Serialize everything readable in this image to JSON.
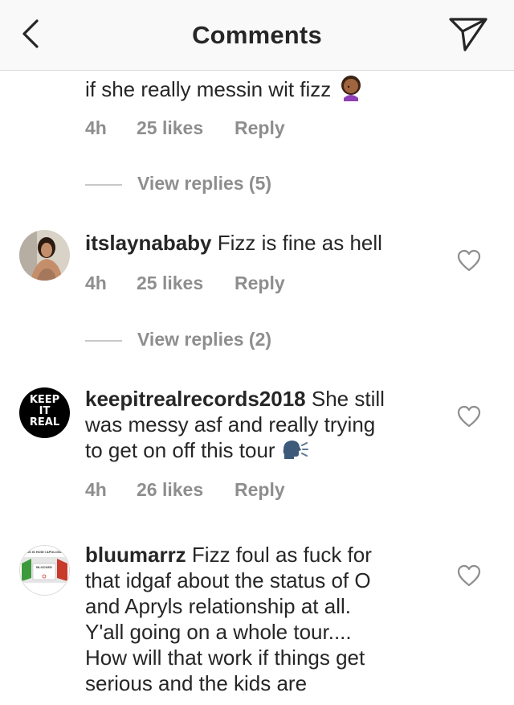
{
  "header": {
    "title": "Comments"
  },
  "comments": [
    {
      "text": "if she really messin wit fizz",
      "emoji": "face-palm-emoji",
      "time": "4h",
      "likes": "25 likes",
      "reply": "Reply",
      "view_replies": "View replies (5)"
    },
    {
      "username": "itslaynababy",
      "text": "Fizz is fine as hell",
      "time": "4h",
      "likes": "25 likes",
      "reply": "Reply",
      "view_replies": "View replies (2)"
    },
    {
      "username": "keepitrealrecords2018",
      "text_line1": "She still",
      "text_line2": "was messy asf and really trying",
      "text_line3": "to get on off this tour",
      "emoji": "speaking-head-emoji",
      "time": "4h",
      "likes": "26 likes",
      "reply": "Reply",
      "avatar_text": [
        "KEEP",
        "IT",
        "REAL"
      ]
    },
    {
      "username": "bluumarrz",
      "text_line1": "Fizz foul as fuck for",
      "text_line2": "that idgaf about the status of O",
      "text_line3": "and Apryls relationship at all.",
      "text_line4": "Y'all going on a whole tour....",
      "text_line5": "How will that work if things get",
      "text_line6": "serious and the kids are",
      "avatar_text_top": "THIS IS HOW I APOLOGIZE",
      "avatar_text_mid": "BLOCKED"
    }
  ],
  "colors": {
    "text": "#262626",
    "secondary": "#8e8e8e",
    "header_bg": "#f9f9f9"
  }
}
